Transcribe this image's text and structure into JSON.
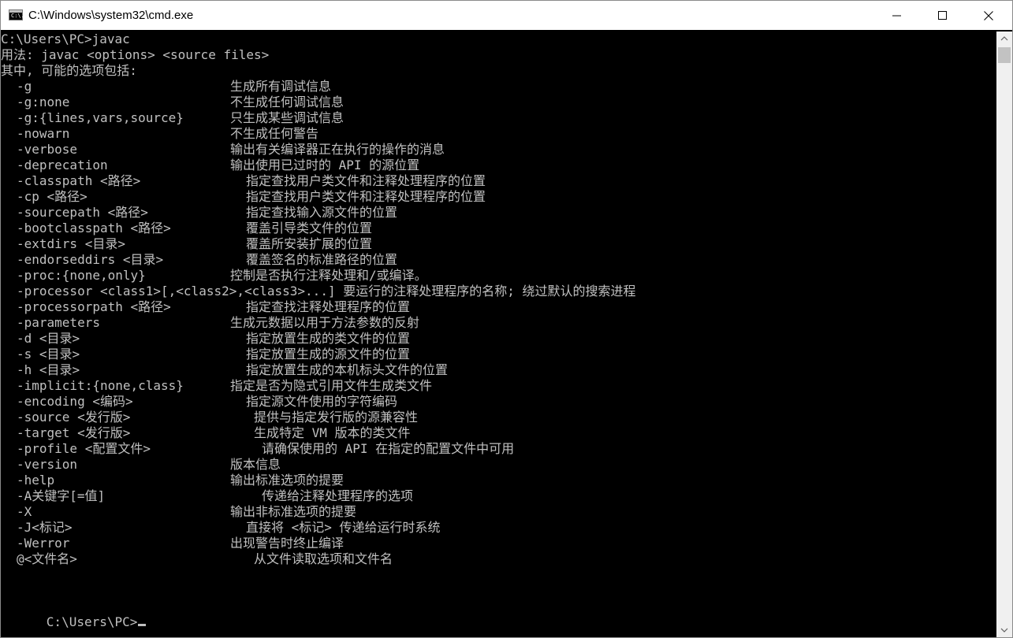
{
  "window": {
    "title": "C:\\Windows\\system32\\cmd.exe",
    "icon_text": "C:\\."
  },
  "console": {
    "header_lines": [
      "C:\\Users\\PC>javac",
      "用法: javac <options> <source files>",
      "其中, 可能的选项包括:"
    ],
    "options": [
      {
        "opt": "-g",
        "desc": "生成所有调试信息",
        "indent": 0
      },
      {
        "opt": "-g:none",
        "desc": "不生成任何调试信息",
        "indent": 0
      },
      {
        "opt": "-g:{lines,vars,source}",
        "desc": "只生成某些调试信息",
        "indent": 0
      },
      {
        "opt": "-nowarn",
        "desc": "不生成任何警告",
        "indent": 0
      },
      {
        "opt": "-verbose",
        "desc": "输出有关编译器正在执行的操作的消息",
        "indent": 0
      },
      {
        "opt": "-deprecation",
        "desc": "输出使用已过时的 API 的源位置",
        "indent": 0
      },
      {
        "opt": "-classpath <路径>",
        "desc": "指定查找用户类文件和注释处理程序的位置",
        "indent": 2
      },
      {
        "opt": "-cp <路径>",
        "desc": "指定查找用户类文件和注释处理程序的位置",
        "indent": 2
      },
      {
        "opt": "-sourcepath <路径>",
        "desc": "指定查找输入源文件的位置",
        "indent": 2
      },
      {
        "opt": "-bootclasspath <路径>",
        "desc": "覆盖引导类文件的位置",
        "indent": 2
      },
      {
        "opt": "-extdirs <目录>",
        "desc": "覆盖所安装扩展的位置",
        "indent": 2
      },
      {
        "opt": "-endorseddirs <目录>",
        "desc": "覆盖签名的标准路径的位置",
        "indent": 2
      },
      {
        "opt": "-proc:{none,only}",
        "desc": "控制是否执行注释处理和/或编译。",
        "indent": 0
      },
      {
        "opt": "-processor <class1>[,<class2>,<class3>...] 要运行的注释处理程序的名称; 绕过默认的搜索进程",
        "desc": "",
        "indent": 0
      },
      {
        "opt": "-processorpath <路径>",
        "desc": "指定查找注释处理程序的位置",
        "indent": 2
      },
      {
        "opt": "-parameters",
        "desc": "生成元数据以用于方法参数的反射",
        "indent": 0
      },
      {
        "opt": "-d <目录>",
        "desc": "指定放置生成的类文件的位置",
        "indent": 2
      },
      {
        "opt": "-s <目录>",
        "desc": "指定放置生成的源文件的位置",
        "indent": 2
      },
      {
        "opt": "-h <目录>",
        "desc": "指定放置生成的本机标头文件的位置",
        "indent": 2
      },
      {
        "opt": "-implicit:{none,class}",
        "desc": "指定是否为隐式引用文件生成类文件",
        "indent": 0
      },
      {
        "opt": "-encoding <编码>",
        "desc": "指定源文件使用的字符编码",
        "indent": 2
      },
      {
        "opt": "-source <发行版>",
        "desc": "提供与指定发行版的源兼容性",
        "indent": 3
      },
      {
        "opt": "-target <发行版>",
        "desc": "生成特定 VM 版本的类文件",
        "indent": 3
      },
      {
        "opt": "-profile <配置文件>",
        "desc": "请确保使用的 API 在指定的配置文件中可用",
        "indent": 4
      },
      {
        "opt": "-version",
        "desc": "版本信息",
        "indent": 0
      },
      {
        "opt": "-help",
        "desc": "输出标准选项的提要",
        "indent": 0
      },
      {
        "opt": "-A关键字[=值]",
        "desc": "传递给注释处理程序的选项",
        "indent": 4
      },
      {
        "opt": "-X",
        "desc": "输出非标准选项的提要",
        "indent": 0
      },
      {
        "opt": "-J<标记>",
        "desc": "直接将 <标记> 传递给运行时系统",
        "indent": 2
      },
      {
        "opt": "-Werror",
        "desc": "出现警告时终止编译",
        "indent": 0
      },
      {
        "opt": "@<文件名>",
        "desc": "从文件读取选项和文件名",
        "indent": 3
      }
    ],
    "prompt": "C:\\Users\\PC>"
  },
  "colors": {
    "console_bg": "#000000",
    "console_fg": "#c0c0c0",
    "titlebar_bg": "#ffffff"
  }
}
